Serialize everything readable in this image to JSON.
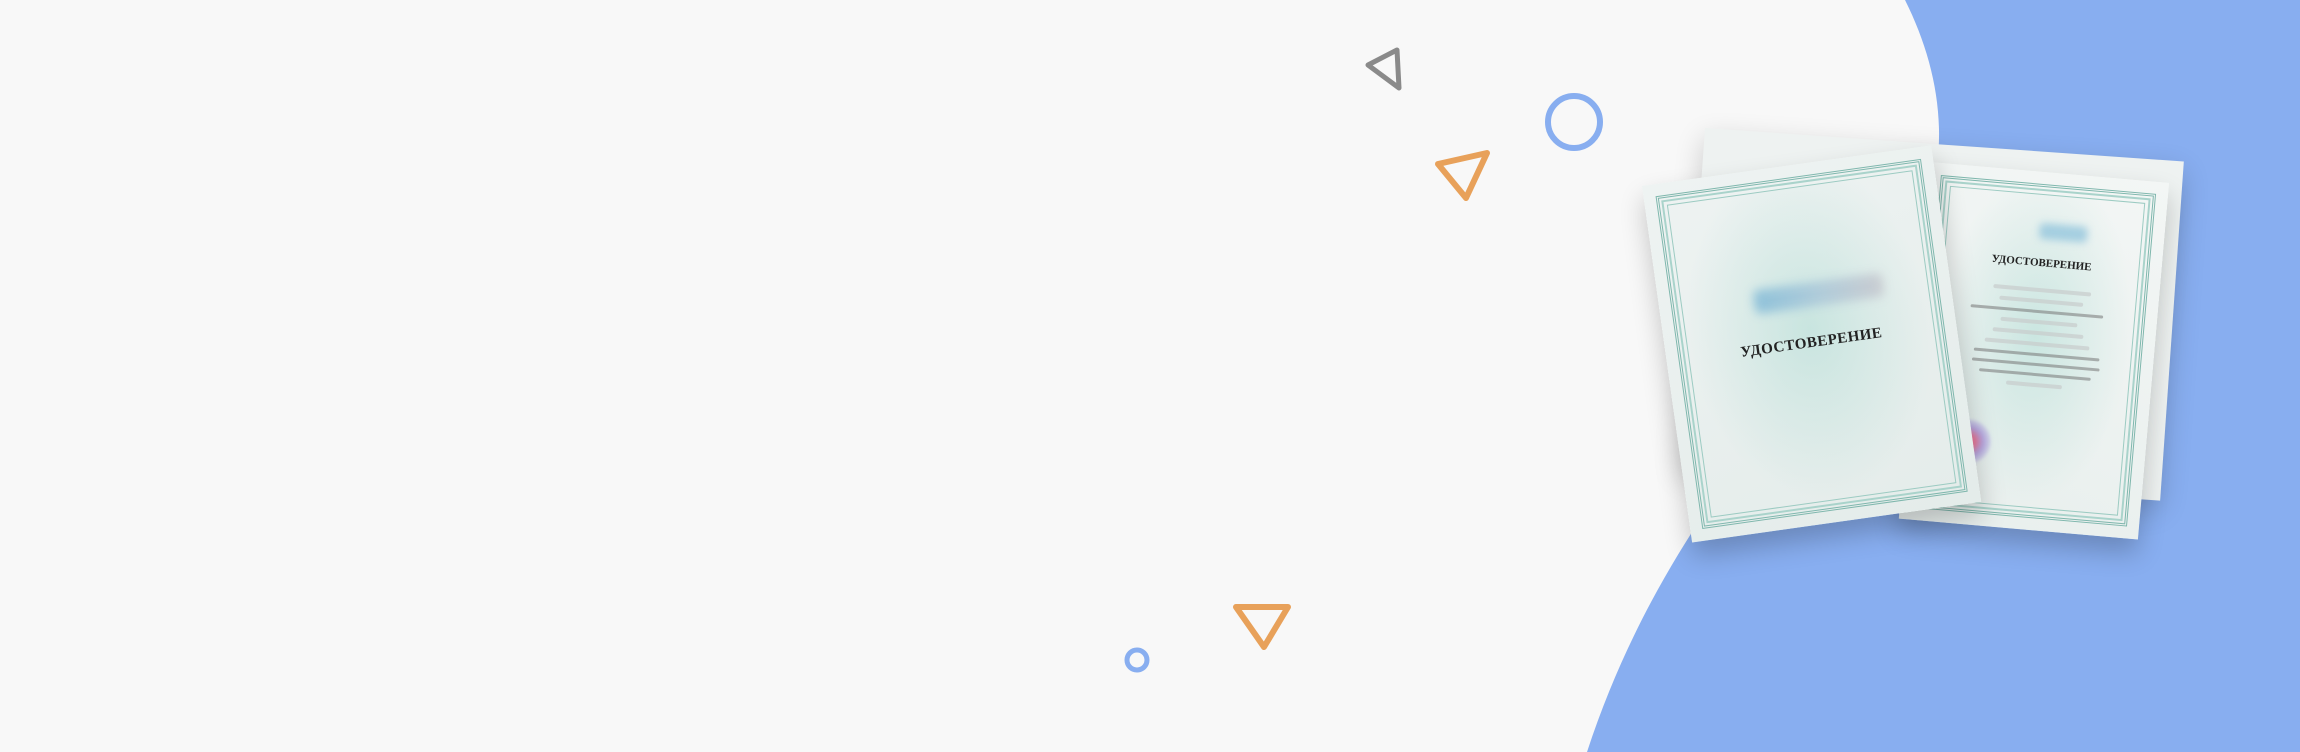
{
  "colors": {
    "background": "#f8f8f8",
    "blob": "#88aef0",
    "triangle_orange": "#e8a15a",
    "triangle_gray": "#8a8a8a",
    "circle_blue": "#88aef0"
  },
  "certificate": {
    "cover_title": "УДОСТОВЕРЕНИЕ",
    "inner_title": "УДОСТОВЕРЕНИЕ"
  },
  "decorations": [
    "triangle-outline-icon",
    "circle-outline-icon"
  ]
}
